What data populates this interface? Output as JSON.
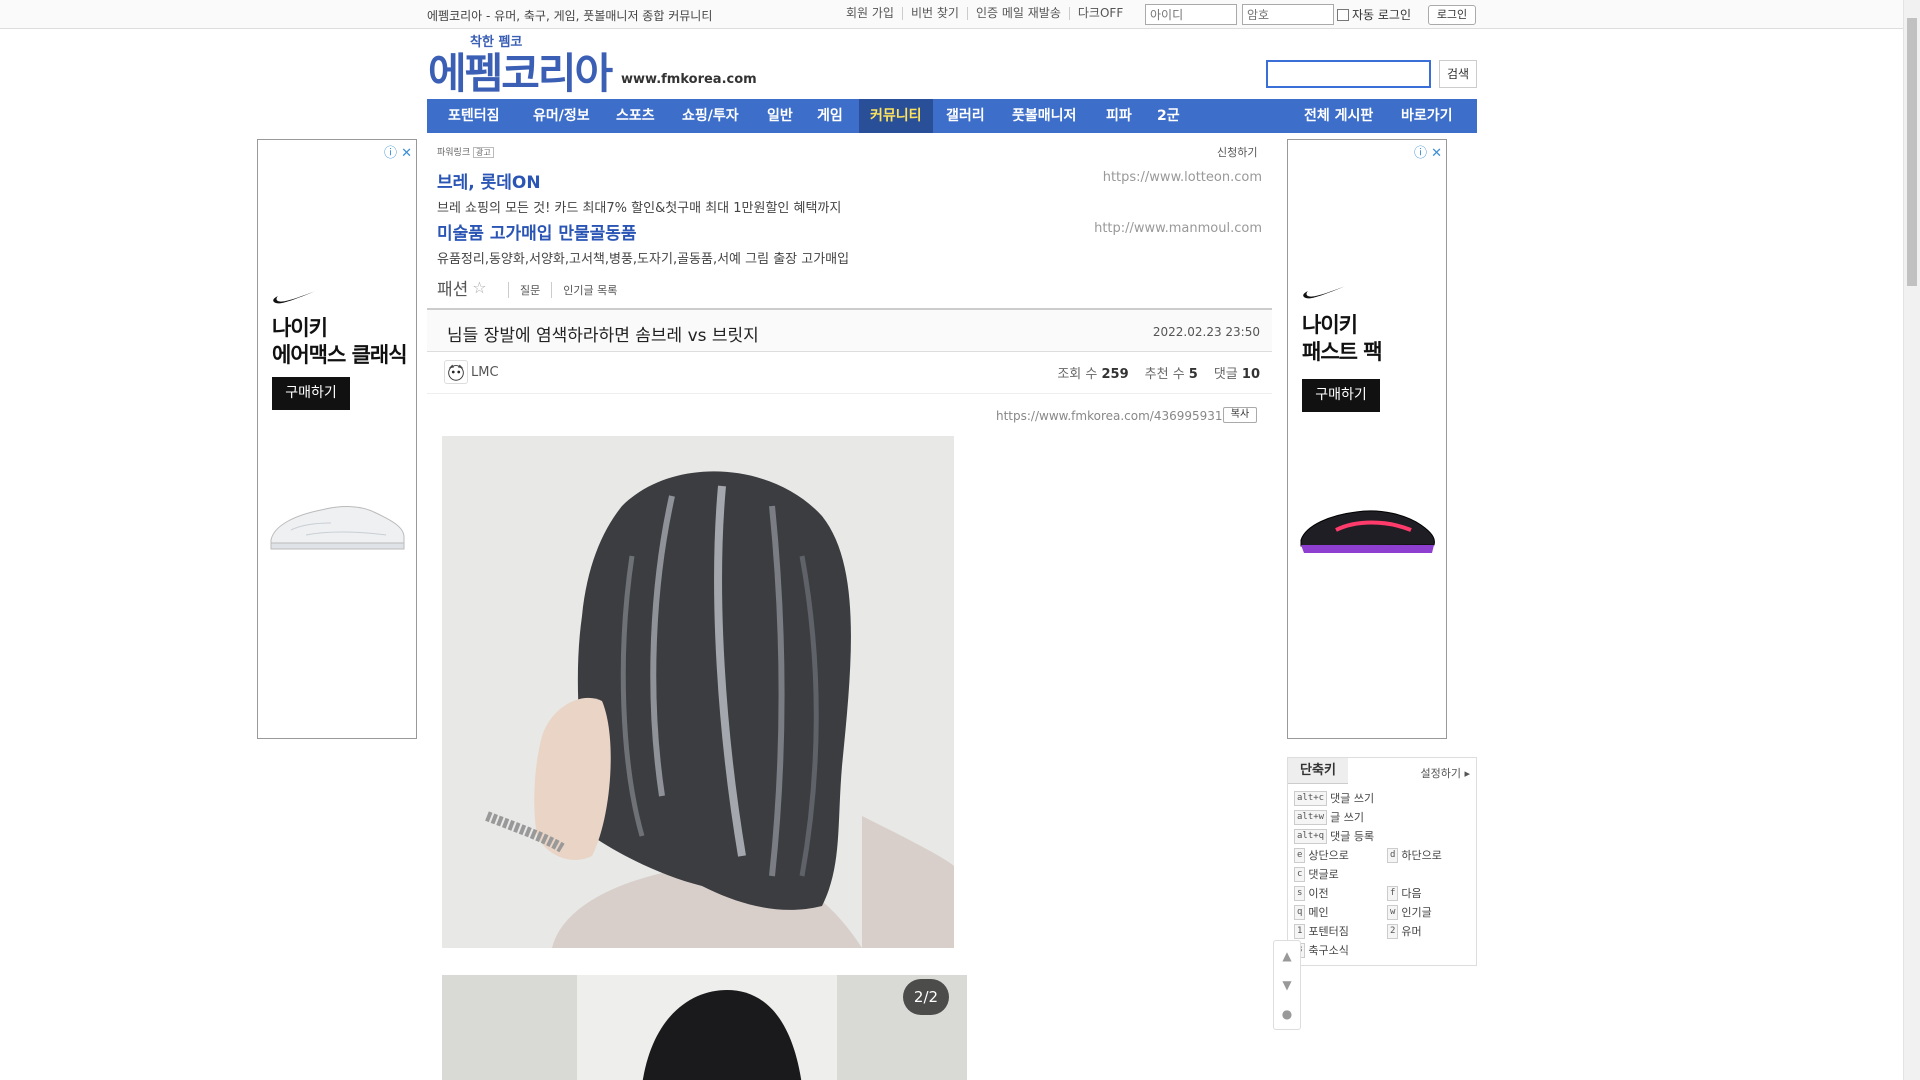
{
  "topbar": {
    "tagline": "에펨코리아 - 유머, 축구, 게임, 풋볼매니저 종합 커뮤니티",
    "links": [
      "회원 가입",
      "비번 찾기",
      "인증 메일 재발송",
      "다크OFF"
    ],
    "id_placeholder": "아이디",
    "pw_placeholder": "암호",
    "auto_login": "자동 로그인",
    "login_btn": "로그인"
  },
  "header": {
    "logo_small": "착한 펨코",
    "logo": "에펨코리아",
    "domain": "www.fmkorea.com",
    "search_btn": "검색"
  },
  "nav": {
    "items": [
      "포텐터짐",
      "유머/정보",
      "스포츠",
      "쇼핑/투자",
      "일반",
      "게임",
      "커뮤니티",
      "갤러리",
      "풋볼매니저",
      "피파",
      "2군"
    ],
    "active": "커뮤니티",
    "right_items": [
      "전체 게시판",
      "바로가기"
    ]
  },
  "ads": {
    "left": {
      "title_line1": "나이키",
      "title_line2": "에어맥스 클래식",
      "buy": "구매하기"
    },
    "right": {
      "title_line1": "나이키",
      "title_line2": "패스트 팩",
      "buy": "구매하기"
    },
    "powerlink_label": "파워링크",
    "powerlink_badge": "광고",
    "powerlink_apply": "신청하기",
    "text_ads": [
      {
        "title": "브레, 롯데ON",
        "desc": "브레 쇼핑의 모든 것! 카드 최대7% 할인&첫구매 최대 1만원할인 혜택까지",
        "url": "https://www.lotteon.com"
      },
      {
        "title": "미술품 고가매입 만물골동품",
        "desc": "유품정리,동양화,서양화,고서책,병풍,도자기,골동품,서예 그림 출장 고가매입",
        "url": "http://www.manmoul.com"
      }
    ]
  },
  "board": {
    "name": "패션",
    "links": [
      "질문",
      "인기글 목록"
    ]
  },
  "post": {
    "title": "님들 장발에 염색하라하면 솜브레 vs 브릿지",
    "date": "2022.02.23 23:50",
    "author": "LMC",
    "views_label": "조회 수",
    "views": "259",
    "likes_label": "추천 수",
    "likes": "5",
    "comments_label": "댓글",
    "comments": "10",
    "permalink": "https://www.fmkorea.com/4369959316",
    "copy": "복사",
    "image_counter": "2/2"
  },
  "shortcuts": {
    "tab": "단축키",
    "setting": "설정하기",
    "items": [
      {
        "key": "alt+c",
        "label": "댓글 쓰기"
      },
      {
        "key": "alt+w",
        "label": "글 쓰기"
      },
      {
        "key": "alt+q",
        "label": "댓글 등록"
      },
      {
        "key": "e",
        "label": "상단으로"
      },
      {
        "key": "d",
        "label": "하단으로"
      },
      {
        "key": "c",
        "label": "댓글로"
      },
      {
        "key": "s",
        "label": "이전"
      },
      {
        "key": "f",
        "label": "다음"
      },
      {
        "key": "q",
        "label": "메인"
      },
      {
        "key": "w",
        "label": "인기글"
      },
      {
        "key": "1",
        "label": "포텐터짐"
      },
      {
        "key": "2",
        "label": "유머"
      },
      {
        "key": "3",
        "label": "축구소식"
      }
    ]
  }
}
